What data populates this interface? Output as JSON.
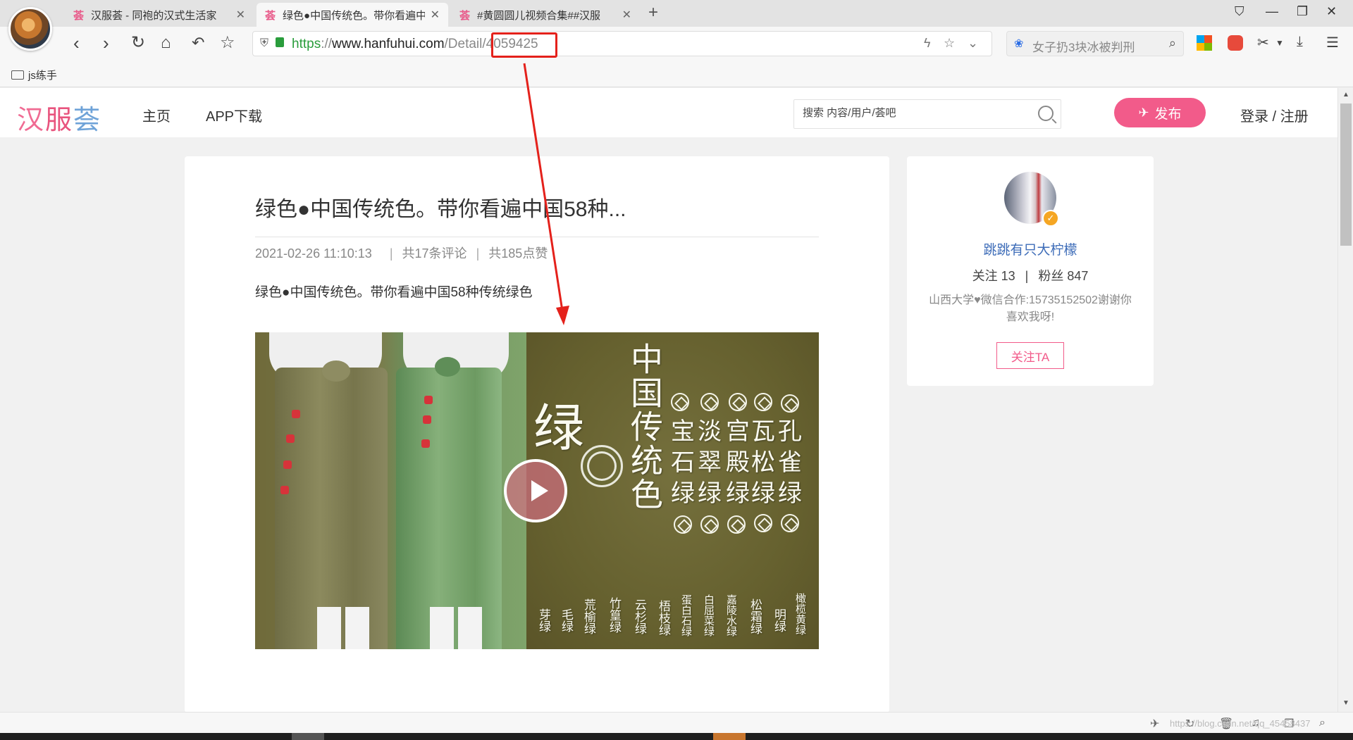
{
  "browser": {
    "tabs": [
      {
        "title": "汉服荟 - 同袍的汉式生活家",
        "favicon": "荟",
        "active": false
      },
      {
        "title": "绿色●中国传统色。带你看遍中",
        "favicon": "荟",
        "active": true
      },
      {
        "title": "#黄圆圆儿视频合集##汉服",
        "favicon": "荟",
        "active": false
      }
    ],
    "url": {
      "scheme": "https",
      "sep": "://",
      "host": "www.hanfuhui.com",
      "path": "/Detail",
      "highlighted": "/4059425"
    },
    "search_placeholder": "女子扔3块冰被判刑",
    "bookmark": "js练手",
    "annotation_color": "#e4211b"
  },
  "site": {
    "logo": [
      "汉",
      "服",
      "荟"
    ],
    "nav": [
      "主页",
      "APP下载"
    ],
    "search_placeholder": "搜索 内容/用户/荟吧",
    "publish_label": "发布",
    "login_label": "登录 / 注册",
    "accent_color": "#f25b8a"
  },
  "post": {
    "title": "绿色●中国传统色。带你看遍中国58种...",
    "date": "2021-02-26 11:10:13",
    "sep": "|",
    "comments": "共17条评论",
    "likes": "共185点赞",
    "description": "绿色●中国传统色。带你看遍中国58种传统绿色",
    "video": {
      "title_big": "中国传统色",
      "lv": "绿",
      "names_row1": [
        "宝",
        "淡",
        "宫",
        "瓦",
        "孔"
      ],
      "names_row2": [
        "石",
        "翠",
        "殿",
        "松",
        "雀"
      ],
      "names_row3": [
        "绿",
        "绿",
        "绿",
        "绿",
        "绿"
      ],
      "bottom_labels": [
        "芽绿",
        "毛绿",
        "荒榆绿",
        "竹篁绿",
        "云杉绿",
        "梧枝绿",
        "蛋白石绿",
        "白屈菜绿",
        "嘉陵水绿",
        "松霜绿",
        "明绿",
        "橄榄黄绿"
      ]
    }
  },
  "author": {
    "name": "跳跳有只大柠檬",
    "following_label": "关注 13",
    "stats_sep": "|",
    "fans_label": "粉丝 847",
    "bio": "山西大学♥微信合作:15735152502谢谢你喜欢我呀!",
    "follow_label": "关注TA",
    "badge": "✓"
  },
  "status": {
    "watermark": "https://blog.csdn.net/qq_45458437"
  }
}
